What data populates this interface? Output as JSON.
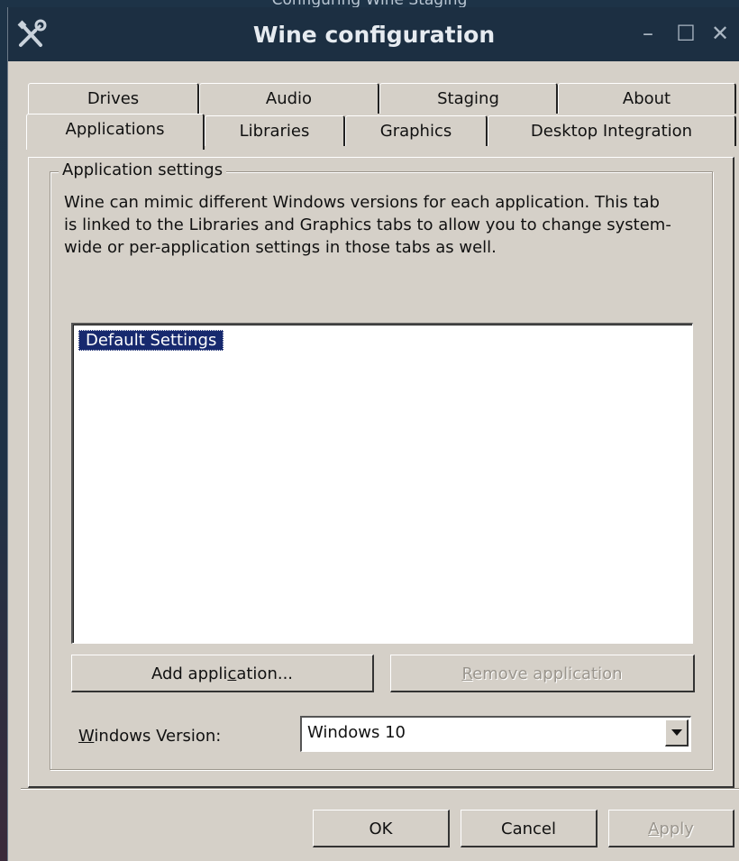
{
  "window": {
    "title": "Wine configuration",
    "desktop_title_fragment": "Configuring Wine Staging",
    "icon": "tools-icon"
  },
  "tabs": {
    "row1": [
      "Drives",
      "Audio",
      "Staging",
      "About"
    ],
    "row2": [
      "Applications",
      "Libraries",
      "Graphics",
      "Desktop Integration"
    ],
    "active": "Applications"
  },
  "app_settings": {
    "group_label": "Application settings",
    "description": "Wine can mimic different Windows versions for each application. This tab is linked to the Libraries and Graphics tabs to allow you to change system-wide or per-application settings in those tabs as well.",
    "list_items": [
      "Default Settings"
    ],
    "add_button": "Add application...",
    "remove_button": "Remove application",
    "windows_version_label": "Windows Version:",
    "windows_version_value": "Windows 10"
  },
  "footer": {
    "ok": "OK",
    "cancel": "Cancel",
    "apply": "Apply"
  }
}
